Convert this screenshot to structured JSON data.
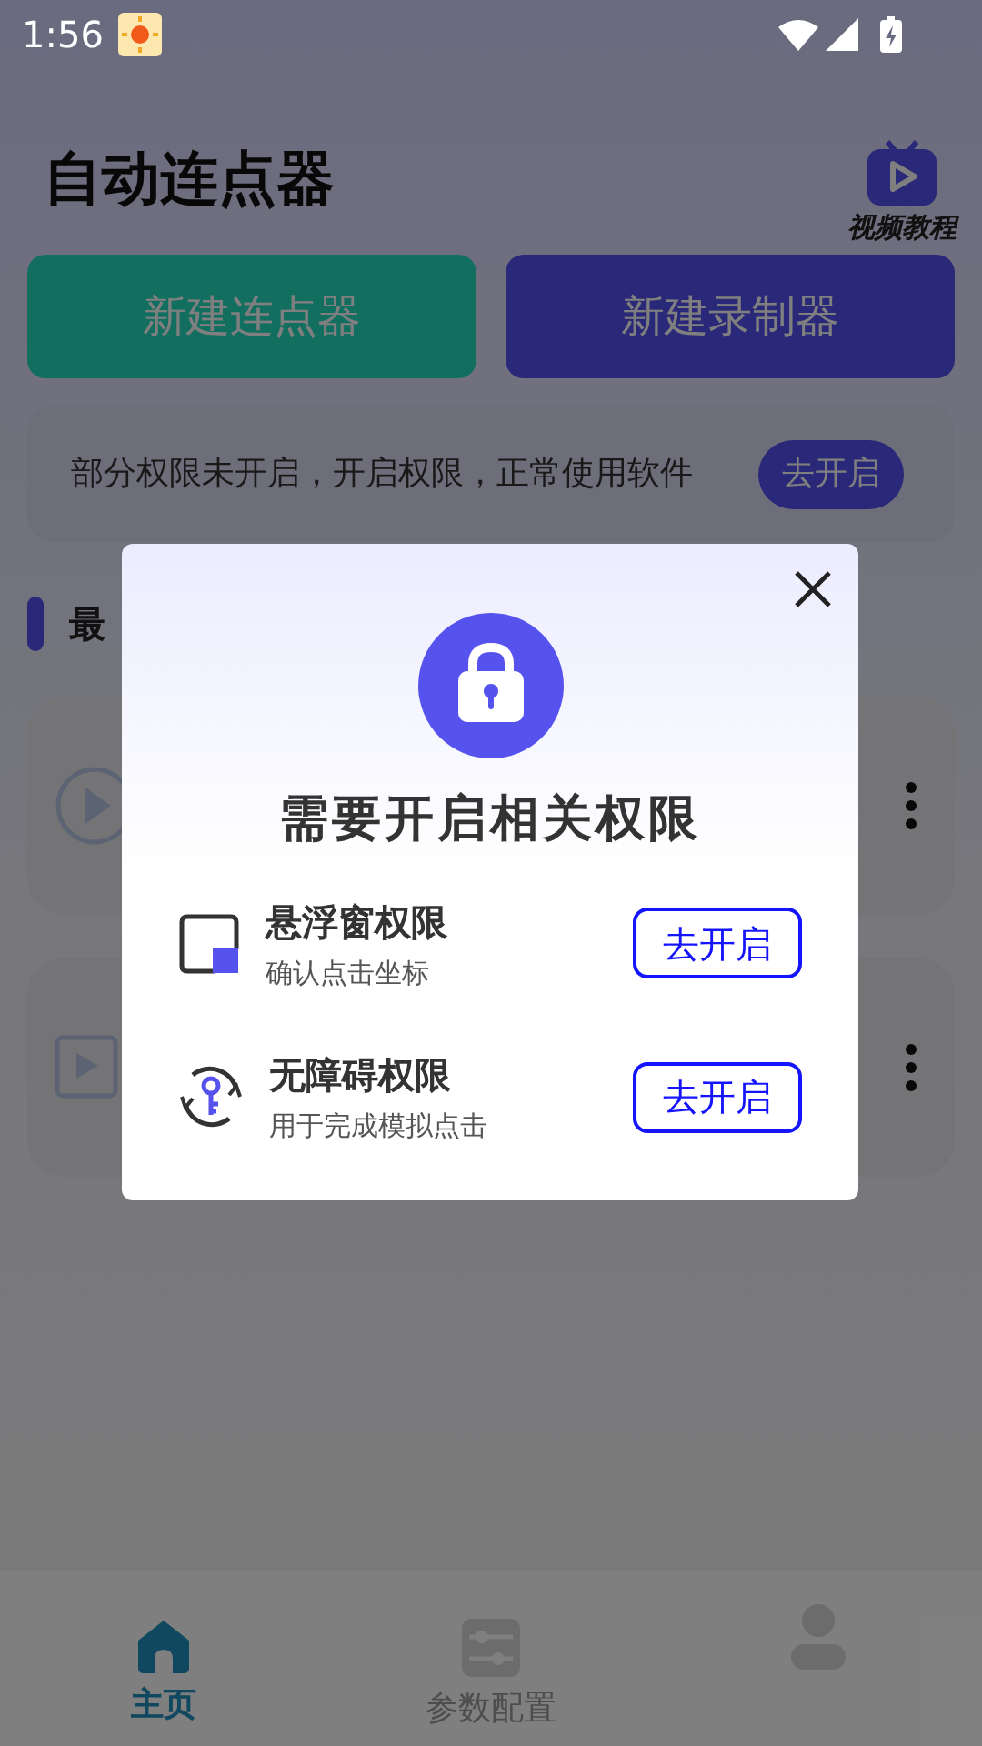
{
  "status_bar": {
    "time": "1:56"
  },
  "header": {
    "title": "自动连点器",
    "video_link": "视频教程"
  },
  "actions": [
    {
      "label": "新建连点器",
      "kind": "clicker"
    },
    {
      "label": "新建录制器",
      "kind": "recorder"
    }
  ],
  "permission_banner": {
    "text": "部分权限未开启，开启权限，正常使用软件",
    "button": "去开启"
  },
  "section": {
    "title": "最"
  },
  "records": [
    {
      "kind": "circle"
    },
    {
      "kind": "square"
    }
  ],
  "dialog": {
    "title": "需要开启相关权限",
    "permissions": [
      {
        "kind": "window",
        "title": "悬浮窗权限",
        "description": "确认点击坐标",
        "button": "去开启"
      },
      {
        "kind": "accessibility",
        "title": "无障碍权限",
        "description": "用于完成模拟点击",
        "button": "去开启"
      }
    ]
  },
  "bottom_nav": [
    {
      "kind": "home",
      "label": "主页",
      "selected": true
    },
    {
      "kind": "settings",
      "label": "参数配置",
      "selected": false
    },
    {
      "kind": "profile",
      "selected": false
    }
  ]
}
